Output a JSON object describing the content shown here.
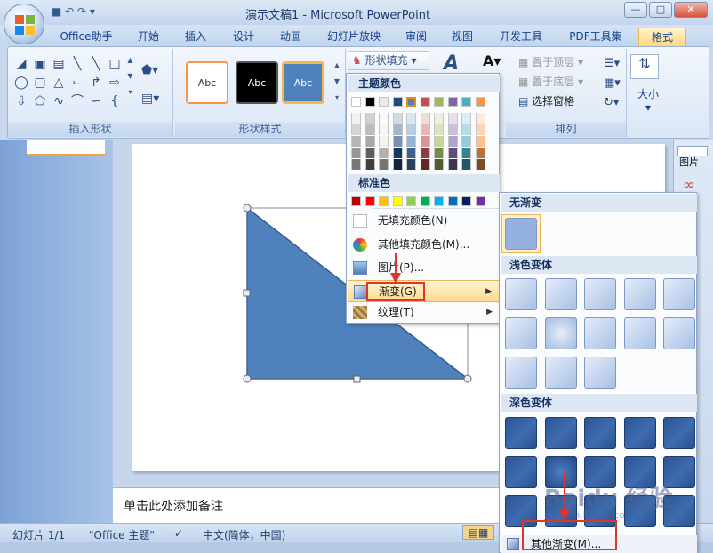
{
  "window": {
    "title": "演示文稿1 - Microsoft PowerPoint",
    "controls": [
      "—",
      "□",
      "✕"
    ]
  },
  "tabs": [
    "Office助手",
    "开始",
    "插入",
    "设计",
    "动画",
    "幻灯片放映",
    "审阅",
    "视图",
    "开发工具",
    "PDF工具集",
    "格式"
  ],
  "active_tab": "格式",
  "ribbon": {
    "groups": {
      "insert_shapes": "插入形状",
      "shape_styles": "形状样式",
      "arrange": "排列"
    },
    "style_samples": [
      "Abc",
      "Abc",
      "Abc"
    ],
    "shape_fill_label": "形状填充",
    "bring_to_front": "置于顶层",
    "send_to_back": "置于底层",
    "selection_pane": "选择窗格",
    "size_label": "大小"
  },
  "right_pane": {
    "picture_label": "图片"
  },
  "fill_menu": {
    "theme_colors_header": "主题颜色",
    "standard_colors_header": "标准色",
    "theme_top_row": [
      "#ffffff",
      "#000000",
      "#eeece1",
      "#1f497d",
      "#4f81bd",
      "#c0504d",
      "#9bbb59",
      "#8064a2",
      "#4bacc6",
      "#f79646"
    ],
    "standard_colors": [
      "#c00000",
      "#ff0000",
      "#ffc000",
      "#ffff00",
      "#92d050",
      "#00b050",
      "#00b0f0",
      "#0070c0",
      "#002060",
      "#7030a0"
    ],
    "items": {
      "no_fill": "无填充颜色(N)",
      "more_colors": "其他填充颜色(M)...",
      "picture": "图片(P)...",
      "gradient": "渐变(G)",
      "texture": "纹理(T)"
    }
  },
  "gradient_menu": {
    "no_gradient_header": "无渐变",
    "light_variations_header": "浅色变体",
    "dark_variations_header": "深色变体",
    "more_gradients": "其他渐变(M)..."
  },
  "notes_placeholder": "单击此处添加备注",
  "status": {
    "slide": "幻灯片 1/1",
    "theme": "\"Office 主题\"",
    "language": "中文(简体，中国)"
  },
  "shape": {
    "fill_color": "#4f81bd"
  },
  "watermark": {
    "brand": "Baidu 经验",
    "url": "jingyan.baidu.com"
  }
}
